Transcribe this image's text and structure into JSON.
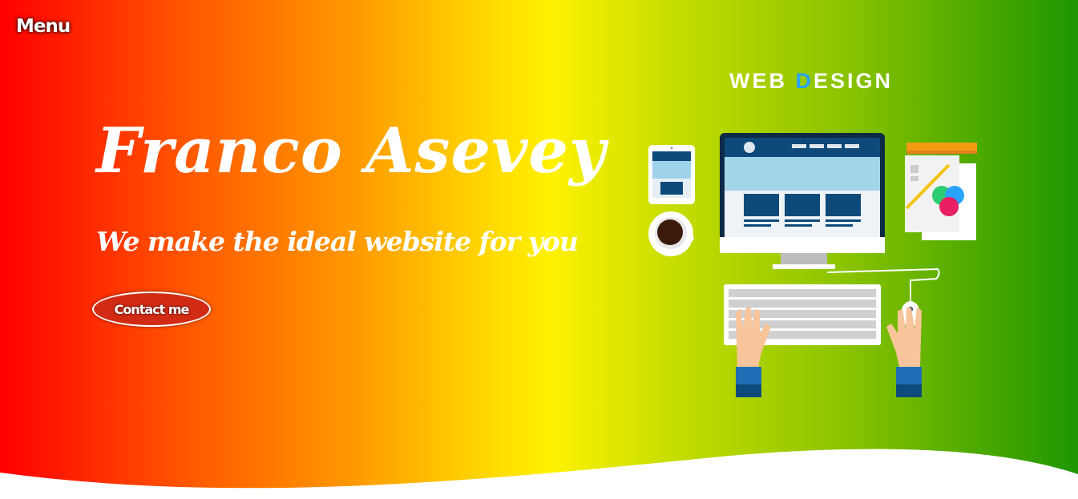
{
  "nav": {
    "menu_label": "Menu"
  },
  "hero": {
    "title": "Franco Asevey",
    "subtitle": "We make the ideal website for you",
    "cta_label": "Contact me"
  },
  "illustration": {
    "title_part1": "WEB ",
    "title_accent": "D",
    "title_part2": "ESIGN",
    "icons": [
      "tablet-icon",
      "coffee-cup-icon",
      "monitor-icon",
      "color-palette-icon",
      "keyboard-icon",
      "mouse-icon",
      "hands-icon"
    ]
  },
  "colors": {
    "gradient_start": "#ff0000",
    "gradient_mid": "#fff200",
    "gradient_end": "#1e9600",
    "accent": "#29a3ff",
    "cta_bg": "#d12b14"
  }
}
